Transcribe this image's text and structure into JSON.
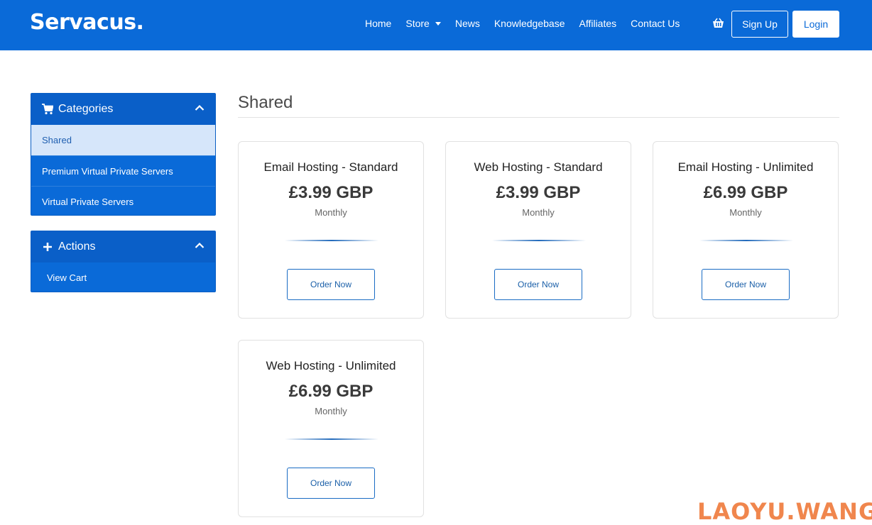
{
  "header": {
    "logo": "Servacus.",
    "nav": [
      "Home",
      "Store",
      "News",
      "Knowledgebase",
      "Affiliates",
      "Contact Us"
    ],
    "signup_label": "Sign Up",
    "login_label": "Login"
  },
  "sidebar": {
    "categories": {
      "title": "Categories",
      "items": [
        {
          "label": "Shared",
          "active": true
        },
        {
          "label": "Premium Virtual Private Servers"
        },
        {
          "label": "Virtual Private Servers"
        }
      ]
    },
    "actions": {
      "title": "Actions",
      "items": [
        {
          "label": "View Cart"
        }
      ]
    }
  },
  "main": {
    "title": "Shared",
    "products": [
      {
        "name": "Email Hosting - Standard",
        "price": "£3.99 GBP",
        "cycle": "Monthly",
        "button": "Order Now"
      },
      {
        "name": "Web Hosting - Standard",
        "price": "£3.99 GBP",
        "cycle": "Monthly",
        "button": "Order Now"
      },
      {
        "name": "Email Hosting - Unlimited",
        "price": "£6.99 GBP",
        "cycle": "Monthly",
        "button": "Order Now"
      },
      {
        "name": "Web Hosting - Unlimited",
        "price": "£6.99 GBP",
        "cycle": "Monthly",
        "button": "Order Now"
      }
    ]
  },
  "watermark": "LAOYU.WANG",
  "colors": {
    "brand": "#0a6ad8",
    "active_item_bg": "#d6e6fa",
    "watermark": "#ef7a3a"
  }
}
